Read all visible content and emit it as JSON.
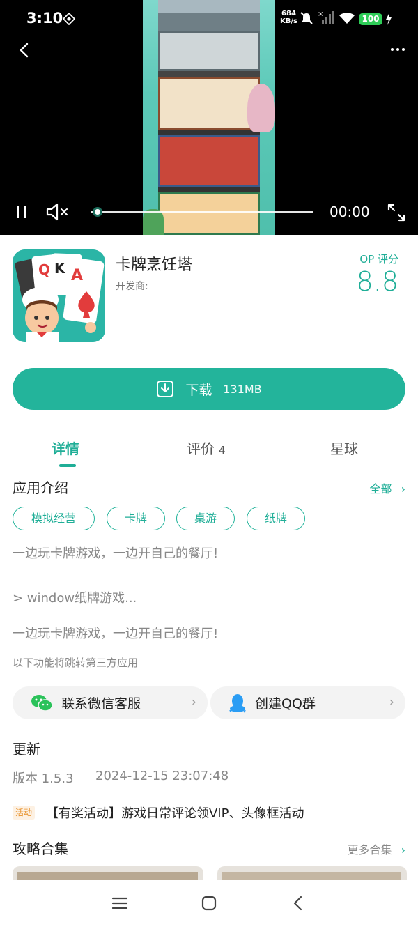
{
  "status_bar": {
    "time": "3:10",
    "net_speed_value": "684",
    "net_speed_unit": "KB/s",
    "battery": "100"
  },
  "video": {
    "elapsed": "00:00",
    "progress": 0.03,
    "muted": true,
    "playing": true
  },
  "app": {
    "name": "卡牌烹饪塔",
    "developer_label": "开发商:",
    "rating_label": "OP 评分",
    "rating": "8.8",
    "icon_cards": [
      "Q",
      "K",
      "A"
    ]
  },
  "download": {
    "label": "下载",
    "size": "131MB"
  },
  "tabs": [
    {
      "label": "详情",
      "count": "",
      "active": true
    },
    {
      "label": "评价",
      "count": "4",
      "active": false
    },
    {
      "label": "星球",
      "count": "",
      "active": false
    }
  ],
  "intro": {
    "title": "应用介绍",
    "all_link": "全部",
    "tags": [
      "模拟经营",
      "卡牌",
      "桌游",
      "纸牌"
    ],
    "line1": "一边玩卡牌游戏，一边开自己的餐厅!",
    "line2": "> window纸牌游戏...",
    "line3": "一边玩卡牌游戏，一边开自己的餐厅!",
    "third_party_note": "以下功能将跳转第三方应用"
  },
  "links": {
    "wechat": "联系微信客服",
    "qq": "创建QQ群"
  },
  "update": {
    "title": "更新",
    "version": "版本 1.5.3",
    "date": "2024-12-15 23:07:48",
    "activity_badge": "活动",
    "activity_text": "【有奖活动】游戏日常评论领VIP、头像框活动"
  },
  "guides": {
    "title": "攻略合集",
    "more_link": "更多合集"
  },
  "colors": {
    "accent": "#23b49b",
    "accent_text": "#1fae97",
    "badge_orange": "#e8912a"
  }
}
